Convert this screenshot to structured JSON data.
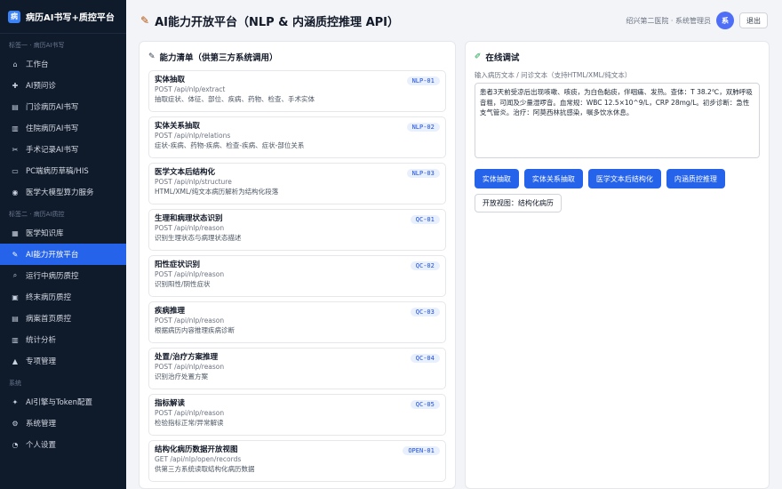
{
  "brand": {
    "logo_text": "病",
    "title": "病历AI书写+质控平台"
  },
  "sidebar": {
    "sections": [
      {
        "label": "标签一 · 病历AI书写",
        "items": [
          {
            "label": "工作台",
            "icon": "home-icon",
            "glyph": "⌂"
          },
          {
            "label": "AI预问诊",
            "icon": "ai-consult-icon",
            "glyph": "✚"
          },
          {
            "label": "门诊病历AI书写",
            "icon": "outpatient-icon",
            "glyph": "▤"
          },
          {
            "label": "住院病历AI书写",
            "icon": "inpatient-icon",
            "glyph": "▥"
          },
          {
            "label": "手术记录AI书写",
            "icon": "surgery-icon",
            "glyph": "✂"
          },
          {
            "label": "PC端病历草稿/HIS",
            "icon": "pc-icon",
            "glyph": "▭"
          },
          {
            "label": "医学大模型算力服务",
            "icon": "brain-icon",
            "glyph": "◉"
          }
        ]
      },
      {
        "label": "标签二 · 病历AI质控",
        "items": [
          {
            "label": "医学知识库",
            "icon": "book-icon",
            "glyph": "▦"
          },
          {
            "label": "AI能力开放平台",
            "icon": "plug-icon",
            "glyph": "✎",
            "active": true
          },
          {
            "label": "运行中病历质控",
            "icon": "search-icon",
            "glyph": "⌕"
          },
          {
            "label": "终末病历质控",
            "icon": "document-icon",
            "glyph": "▣"
          },
          {
            "label": "病案首页质控",
            "icon": "page-icon",
            "glyph": "▤"
          },
          {
            "label": "统计分析",
            "icon": "chart-icon",
            "glyph": "▥"
          },
          {
            "label": "专项管理",
            "icon": "warning-icon",
            "glyph": "▲"
          }
        ]
      },
      {
        "label": "系统",
        "items": [
          {
            "label": "AI引擎与Token配置",
            "icon": "engine-icon",
            "glyph": "✦"
          },
          {
            "label": "系统管理",
            "icon": "gear-icon",
            "glyph": "⚙"
          },
          {
            "label": "个人设置",
            "icon": "user-icon",
            "glyph": "◔"
          }
        ]
      }
    ]
  },
  "header": {
    "title": "AI能力开放平台（NLP & 内涵质控推理 API）",
    "user": "绍兴第二医院 · 系统管理员",
    "avatar_text": "系",
    "logout_label": "退出"
  },
  "capabilities": {
    "title": "能力清单（供第三方系统调用）",
    "items": [
      {
        "name": "实体抽取",
        "endpoint": "POST /api/nlp/extract",
        "desc": "抽取症状、体征、部位、疾病、药物、检查、手术实体",
        "badge": "NLP-01"
      },
      {
        "name": "实体关系抽取",
        "endpoint": "POST /api/nlp/relations",
        "desc": "症状-疾病、药物-疾病、检查-疾病、症状-部位关系",
        "badge": "NLP-02"
      },
      {
        "name": "医学文本后结构化",
        "endpoint": "POST /api/nlp/structure",
        "desc": "HTML/XML/纯文本病历解析为结构化段落",
        "badge": "NLP-03"
      },
      {
        "name": "生理和病理状态识别",
        "endpoint": "POST /api/nlp/reason",
        "desc": "识别生理状态与病理状态描述",
        "badge": "QC-01"
      },
      {
        "name": "阳性症状识别",
        "endpoint": "POST /api/nlp/reason",
        "desc": "识别阳性/阴性症状",
        "badge": "QC-02"
      },
      {
        "name": "疾病推理",
        "endpoint": "POST /api/nlp/reason",
        "desc": "根据病历内容推理疾病诊断",
        "badge": "QC-03"
      },
      {
        "name": "处置/治疗方案推理",
        "endpoint": "POST /api/nlp/reason",
        "desc": "识别治疗处置方案",
        "badge": "QC-04"
      },
      {
        "name": "指标解读",
        "endpoint": "POST /api/nlp/reason",
        "desc": "检验指标正常/异常解读",
        "badge": "QC-05"
      },
      {
        "name": "结构化病历数据开放视图",
        "endpoint": "GET /api/nlp/open/records",
        "desc": "供第三方系统读取结构化病历数据",
        "badge": "OPEN-01"
      }
    ]
  },
  "debug": {
    "title": "在线调试",
    "input_label": "输入病历文本 / 问诊文本（支持HTML/XML/纯文本）",
    "input_value": "患者3天前受凉后出现咳嗽、咳痰，为白色黏痰，伴咽痛、发热。查体：T 38.2℃，双肺呼吸音粗，可闻及少量湿啰音。血常规：WBC 12.5×10^9/L，CRP 28mg/L。初步诊断：急性支气管炎。治疗：阿莫西林抗感染，嘱多饮水休息。",
    "buttons": [
      "实体抽取",
      "实体关系抽取",
      "医学文本后结构化",
      "内涵质控推理"
    ],
    "open_view_label": "开放视图：结构化病历"
  },
  "colors": {
    "sidebar_bg": "#0f1a2b",
    "accent": "#2563eb",
    "badge_bg": "#e8effd"
  }
}
